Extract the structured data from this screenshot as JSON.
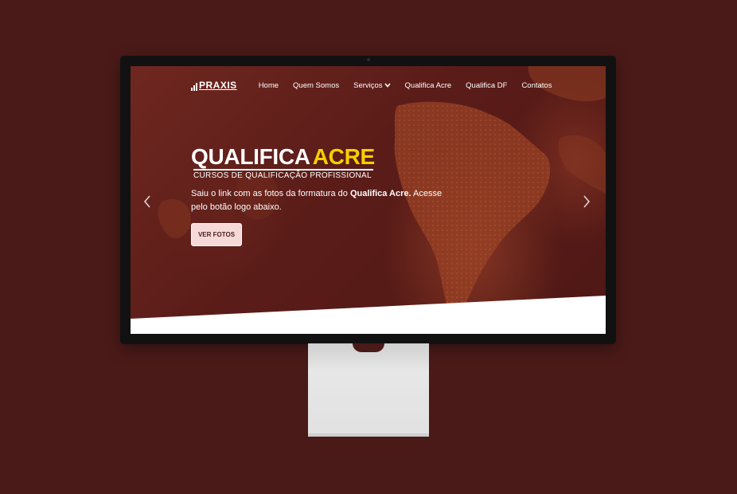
{
  "nav": {
    "logo": "PRAXIS",
    "items": [
      "Home",
      "Quem Somos",
      "Serviços",
      "Qualifica Acre",
      "Qualifica DF",
      "Contatos"
    ],
    "dropdown_icon": "chevron-down-icon"
  },
  "hero": {
    "title_main": "QUALIFICA",
    "title_accent": "ACRE",
    "subtitle": "CURSOS DE QUALIFICAÇÃO PROFISSIONAL",
    "text_before": "Saiu o link com as fotos da formatura do ",
    "text_bold": "Qualifica Acre.",
    "text_after": " Acesse pelo botão logo abaixo.",
    "button": "VER FOTOS"
  },
  "carousel": {
    "prev_icon": "chevron-left-icon",
    "next_icon": "chevron-right-icon"
  },
  "colors": {
    "background": "#4a1a18",
    "accent": "#f5d000",
    "button_bg": "#f6dada"
  }
}
